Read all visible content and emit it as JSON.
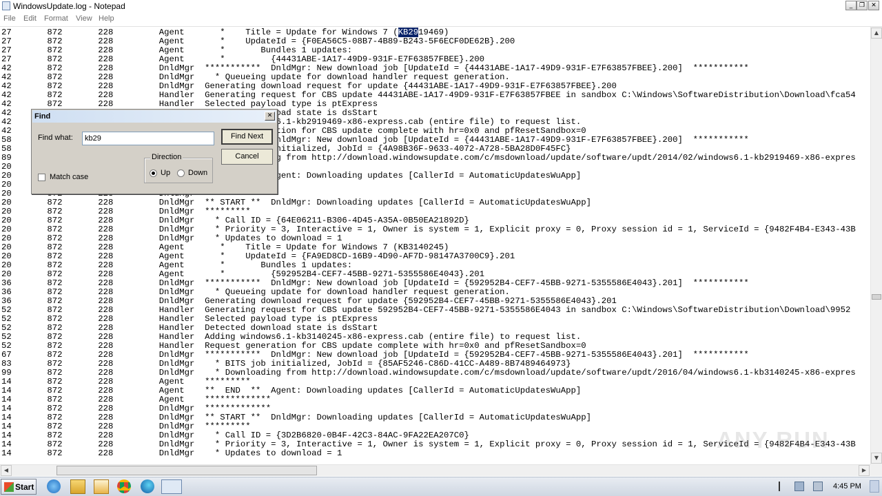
{
  "window": {
    "title": "WindowsUpdate.log - Notepad"
  },
  "menu": [
    "File",
    "Edit",
    "Format",
    "View",
    "Help"
  ],
  "editor": {
    "lines": [
      "27       872       228         Agent       *    Title = Update for Windows 7 (KB2919469)",
      "27       872       228         Agent       *    UpdateId = {F0EA56C5-08B7-4B89-B243-5F6ECF0DE62B}.200",
      "27       872       228         Agent       *       Bundles 1 updates:",
      "27       872       228         Agent       *         {44431ABE-1A17-49D9-931F-E7F63857FBEE}.200",
      "42       872       228         DnldMgr  ***********  DnldMgr: New download job [UpdateId = {44431ABE-1A17-49D9-931F-E7F63857FBEE}.200]  ***********",
      "42       872       228         DnldMgr    * Queueing update for download handler request generation.",
      "42       872       228         DnldMgr  Generating download request for update {44431ABE-1A17-49D9-931F-E7F63857FBEE}.200",
      "42       872       228         Handler  Generating request for CBS update 44431ABE-1A17-49D9-931F-E7F63857FBEE in sandbox C:\\Windows\\SoftwareDistribution\\Download\\fca54",
      "42       872       228         Handler  Selected payload type is ptExpress",
      "42       872       228         Handler  Detected download state is dsStart",
      "42       872       228         Handler  Adding windows6.1-kb2919469-x86-express.cab (entire file) to request list.",
      "42       872       228         Handler  Request generation for CBS update complete with hr=0x0 and pfResetSandbox=0",
      "58       872       228         DnldMgr  ***********  DnldMgr: New download job [UpdateId = {44431ABE-1A17-49D9-931F-E7F63857FBEE}.200]  ***********",
      "58       872       228         DnldMgr    * BITS job initialized, JobId = {4A98B36F-9633-4072-A728-5BA28D0F45FC}",
      "89       872       228         DnldMgr    * Downloading from http://download.windowsupdate.com/c/msdownload/update/software/updt/2014/02/windows6.1-kb2919469-x86-expres",
      "20       872       228         Agent    *********",
      "20       872       228         Agent    **  END  **  Agent: Downloading updates [CallerId = AutomaticUpdatesWuApp]",
      "20       872       228         Agent    *************",
      "20       872       228         DnldMgr  *************",
      "20       872       228         DnldMgr  ** START **  DnldMgr: Downloading updates [CallerId = AutomaticUpdatesWuApp]",
      "20       872       228         DnldMgr  *********",
      "20       872       228         DnldMgr    * Call ID = {64E06211-B306-4D45-A35A-0B50EA21892D}",
      "20       872       228         DnldMgr    * Priority = 3, Interactive = 1, Owner is system = 1, Explicit proxy = 0, Proxy session id = 1, ServiceId = {9482F4B4-E343-43B",
      "20       872       228         DnldMgr    * Updates to download = 1",
      "20       872       228         Agent       *    Title = Update for Windows 7 (KB3140245)",
      "20       872       228         Agent       *    UpdateId = {FA9ED8CD-16B9-4D90-AF7D-98147A3700C9}.201",
      "20       872       228         Agent       *       Bundles 1 updates:",
      "20       872       228         Agent       *         {592952B4-CEF7-45BB-9271-5355586E4043}.201",
      "36       872       228         DnldMgr  ***********  DnldMgr: New download job [UpdateId = {592952B4-CEF7-45BB-9271-5355586E4043}.201]  ***********",
      "36       872       228         DnldMgr    * Queueing update for download handler request generation.",
      "36       872       228         DnldMgr  Generating download request for update {592952B4-CEF7-45BB-9271-5355586E4043}.201",
      "52       872       228         Handler  Generating request for CBS update 592952B4-CEF7-45BB-9271-5355586E4043 in sandbox C:\\Windows\\SoftwareDistribution\\Download\\9952",
      "52       872       228         Handler  Selected payload type is ptExpress",
      "52       872       228         Handler  Detected download state is dsStart",
      "52       872       228         Handler  Adding windows6.1-kb3140245-x86-express.cab (entire file) to request list.",
      "52       872       228         Handler  Request generation for CBS update complete with hr=0x0 and pfResetSandbox=0",
      "67       872       228         DnldMgr  ***********  DnldMgr: New download job [UpdateId = {592952B4-CEF7-45BB-9271-5355586E4043}.201]  ***********",
      "83       872       228         DnldMgr    * BITS job initialized, JobId = {85AF5246-C86D-41CC-A489-8B7489464973}",
      "99       872       228         DnldMgr    * Downloading from http://download.windowsupdate.com/c/msdownload/update/software/updt/2016/04/windows6.1-kb3140245-x86-expres",
      "14       872       228         Agent    *********",
      "14       872       228         Agent    **  END  **  Agent: Downloading updates [CallerId = AutomaticUpdatesWuApp]",
      "14       872       228         Agent    *************",
      "14       872       228         DnldMgr  *************",
      "14       872       228         DnldMgr  ** START **  DnldMgr: Downloading updates [CallerId = AutomaticUpdatesWuApp]",
      "14       872       228         DnldMgr  *********",
      "14       872       228         DnldMgr    * Call ID = {3D2B6820-0B4F-42C3-84AC-9FA22EA207C0}",
      "14       872       228         DnldMgr    * Priority = 3, Interactive = 1, Owner is system = 1, Explicit proxy = 0, Proxy session id = 1, ServiceId = {9482F4B4-E343-43B",
      "14       872       228         DnldMgr    * Updates to download = 1"
    ],
    "highlight": {
      "line": 0,
      "text": "KB29"
    }
  },
  "find_dialog": {
    "title": "Find",
    "find_what_label": "Find what:",
    "find_what_value": "kb29",
    "find_next_label": "Find Next",
    "cancel_label": "Cancel",
    "direction_label": "Direction",
    "up_label": "Up",
    "down_label": "Down",
    "direction_selected": "Up",
    "match_case_label": "Match case",
    "match_case_checked": false
  },
  "taskbar": {
    "start_label": "Start",
    "clock": "4:45 PM",
    "pinned": [
      "ie-icon",
      "explorer-icon",
      "media-player-icon",
      "chrome-icon",
      "edge-icon",
      "notepad-icon"
    ]
  },
  "watermark": "ANY RUN"
}
